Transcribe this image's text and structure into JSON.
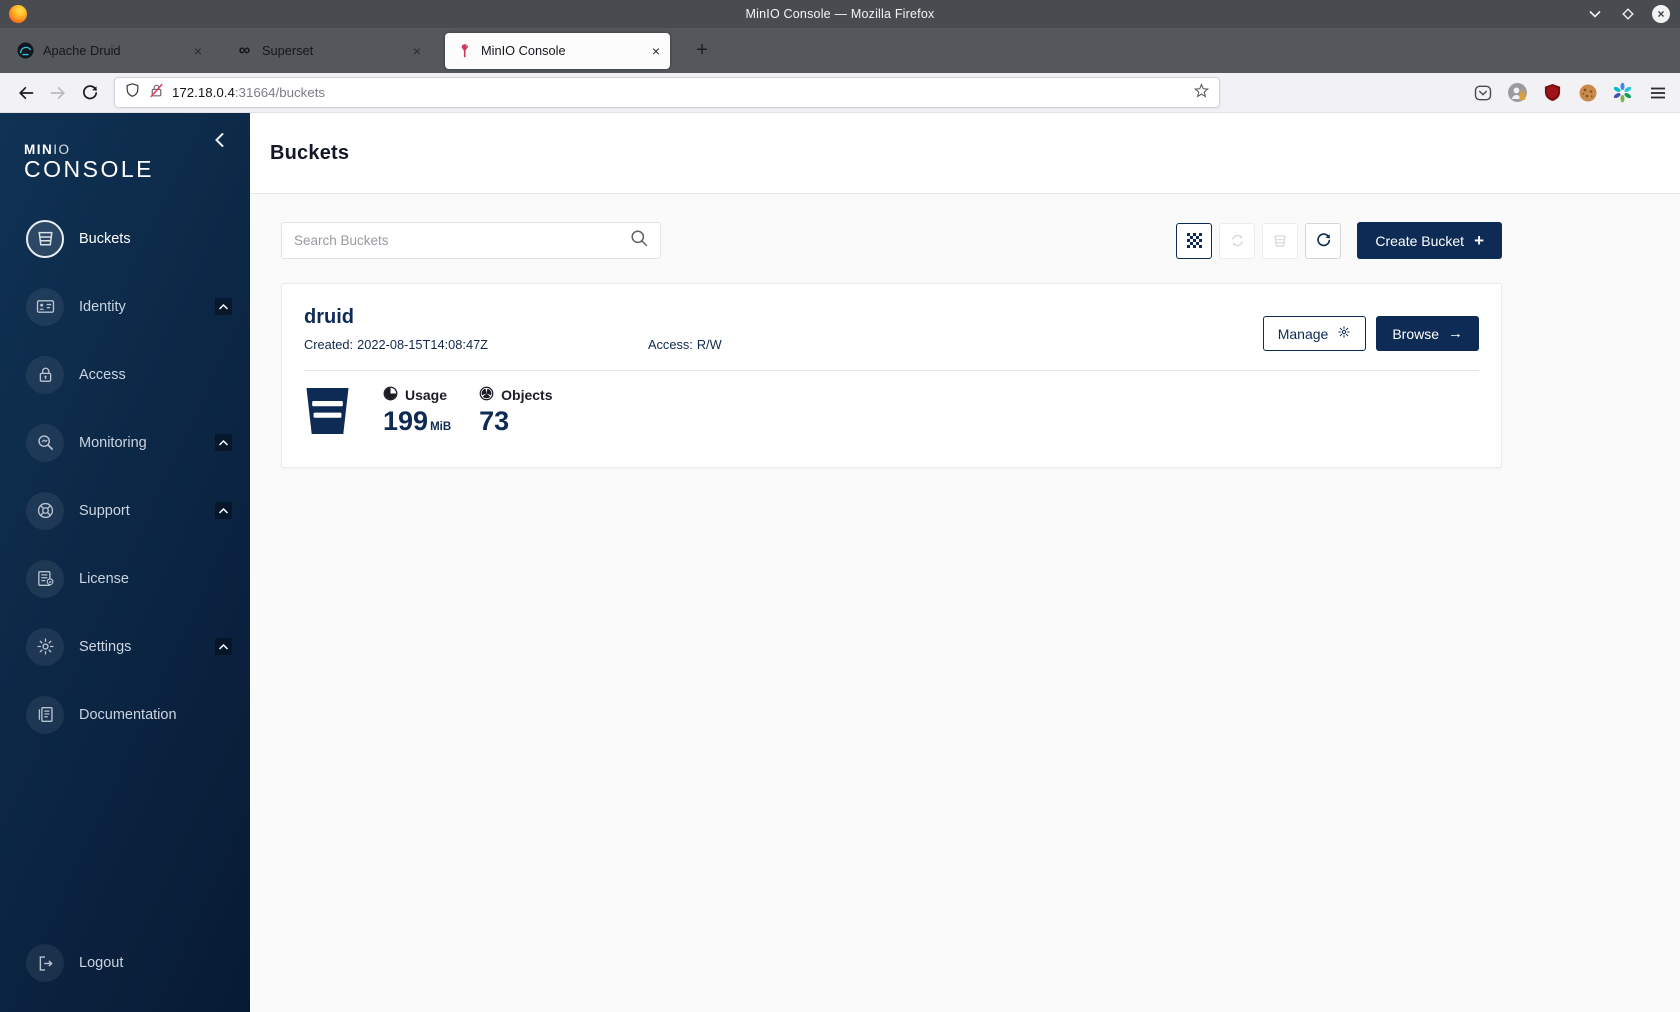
{
  "window": {
    "title": "MinIO Console — Mozilla Firefox"
  },
  "tabs": [
    {
      "label": "Apache Druid"
    },
    {
      "label": "Superset"
    },
    {
      "label": "MinIO Console"
    }
  ],
  "glyphs": {
    "tab_close": "×",
    "new_tab": "+",
    "superset_infinity": "∞",
    "browse_arrow": "→",
    "create_plus": "+"
  },
  "urlbar": {
    "host": "172.18.0.4",
    "path": ":31664/buckets"
  },
  "sidebar": {
    "brand_min": "MIN",
    "brand_io": "IO",
    "brand_line2": "CONSOLE",
    "items": [
      {
        "label": "Buckets"
      },
      {
        "label": "Identity"
      },
      {
        "label": "Access"
      },
      {
        "label": "Monitoring"
      },
      {
        "label": "Support"
      },
      {
        "label": "License"
      },
      {
        "label": "Settings"
      },
      {
        "label": "Documentation"
      }
    ],
    "logout_label": "Logout"
  },
  "page": {
    "title": "Buckets",
    "search_placeholder": "Search Buckets",
    "create_bucket_label": "Create Bucket"
  },
  "bucket": {
    "name": "druid",
    "created_label": "Created:",
    "created_value": "2022-08-15T14:08:47Z",
    "access_label": "Access:",
    "access_value": "R/W",
    "manage_label": "Manage",
    "browse_label": "Browse",
    "usage_label": "Usage",
    "usage_value": "199",
    "usage_unit": "MiB",
    "objects_label": "Objects",
    "objects_value": "73"
  },
  "colors": {
    "primary_navy": "#0e2b55",
    "sidebar_gradient_start": "#103254",
    "sidebar_gradient_end": "#081a33",
    "brand_red": "#d0355a"
  }
}
